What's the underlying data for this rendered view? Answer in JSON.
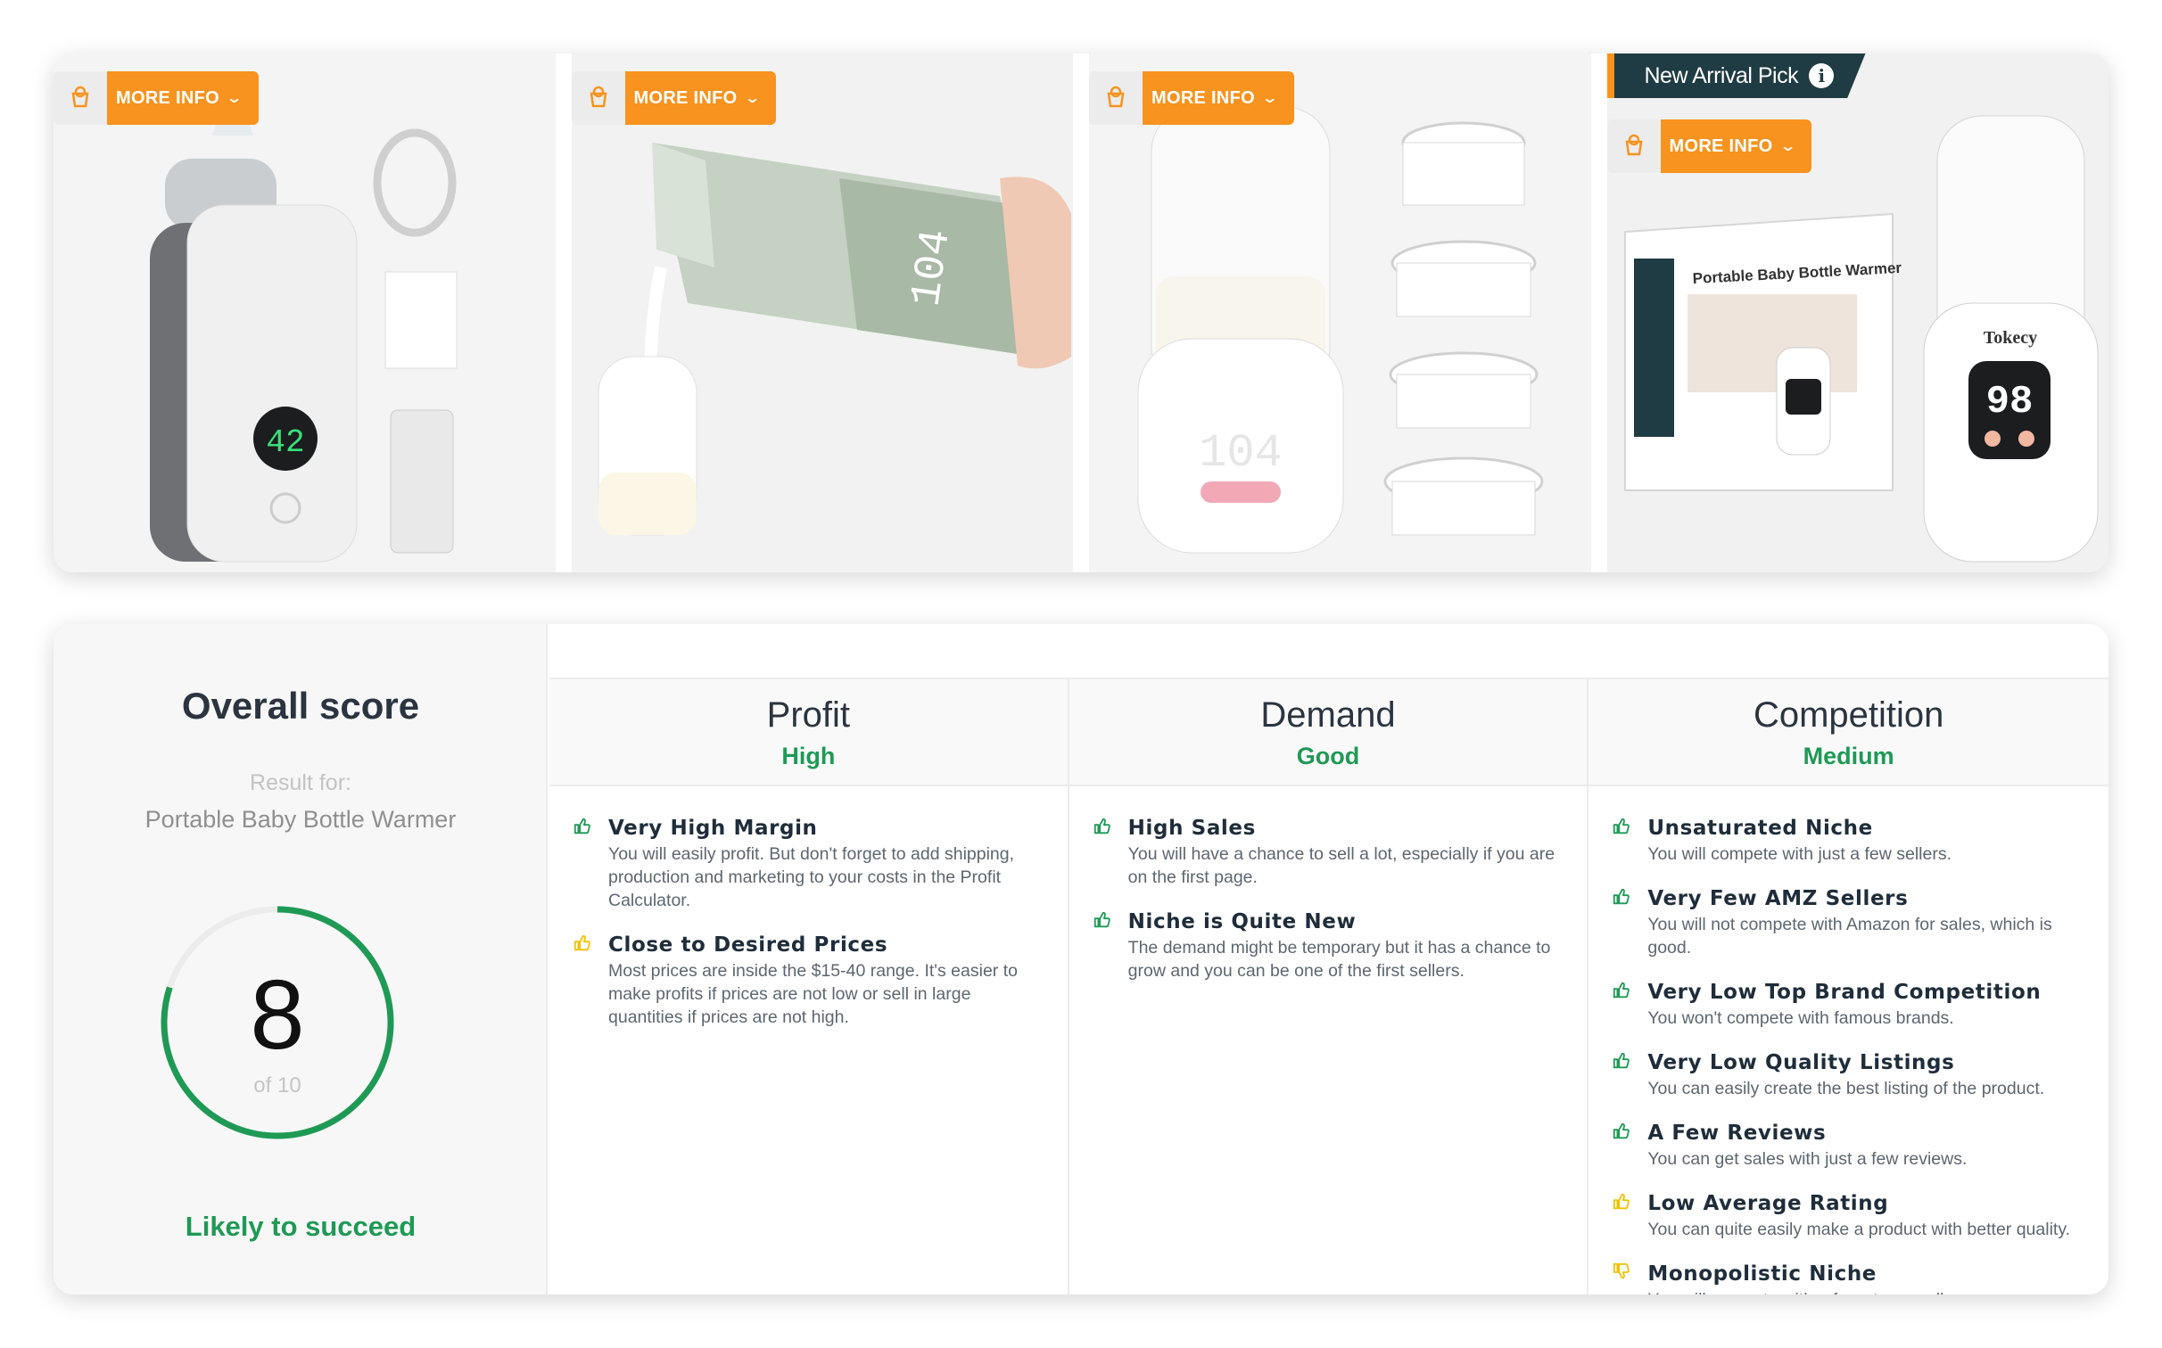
{
  "gallery": {
    "more_info_label": "MORE INFO",
    "badge_label": "New Arrival Pick",
    "accent_color": "#f7931e",
    "badge_color": "#1f3b43",
    "images": [
      {
        "display_labels": [
          "42"
        ]
      },
      {
        "display_labels": [
          "104"
        ]
      },
      {
        "display_labels": [
          "104"
        ]
      },
      {
        "display_labels": [
          "Portable Baby Bottle Warmer",
          "Tokecy",
          "98"
        ]
      }
    ]
  },
  "overall": {
    "title": "Overall score",
    "result_label": "Result for:",
    "result_value": "Portable Baby Bottle Warmer",
    "score": "8",
    "score_of": "of 10",
    "score_fraction": 0.8,
    "verdict": "Likely to succeed",
    "ring_color": "#1e9a55"
  },
  "categories": [
    {
      "title": "Profit",
      "rating": "High",
      "items": [
        {
          "icon": "thumbs-up-icon",
          "color": "#1e9a55",
          "title": "Very High Margin",
          "desc": "You will easily profit. But don't forget to add shipping, production and marketing to your costs in the Profit Calculator."
        },
        {
          "icon": "thumbs-up-icon",
          "color": "#f2c200",
          "title": "Close to Desired Prices",
          "desc": "Most prices are inside the $15-40 range. It's easier to make profits if prices are not low or sell in large quantities if prices are not high."
        }
      ]
    },
    {
      "title": "Demand",
      "rating": "Good",
      "items": [
        {
          "icon": "thumbs-up-icon",
          "color": "#1e9a55",
          "title": "High Sales",
          "desc": "You will have a chance to sell a lot, especially if you are on the first page."
        },
        {
          "icon": "thumbs-up-icon",
          "color": "#1e9a55",
          "title": "Niche is Quite New",
          "desc": "The demand might be temporary but it has a chance to grow and you can be one of the first sellers."
        }
      ]
    },
    {
      "title": "Competition",
      "rating": "Medium",
      "items": [
        {
          "icon": "thumbs-up-icon",
          "color": "#1e9a55",
          "title": "Unsaturated Niche",
          "desc": "You will compete with just a few sellers."
        },
        {
          "icon": "thumbs-up-icon",
          "color": "#1e9a55",
          "title": "Very Few AMZ Sellers",
          "desc": "You will not compete with Amazon for sales, which is good."
        },
        {
          "icon": "thumbs-up-icon",
          "color": "#1e9a55",
          "title": "Very Low Top Brand Competition",
          "desc": "You won't compete with famous brands."
        },
        {
          "icon": "thumbs-up-icon",
          "color": "#1e9a55",
          "title": "Very Low Quality Listings",
          "desc": "You can easily create the best listing of the product."
        },
        {
          "icon": "thumbs-up-icon",
          "color": "#1e9a55",
          "title": "A Few Reviews",
          "desc": "You can get sales with just a few reviews."
        },
        {
          "icon": "thumbs-up-icon",
          "color": "#f2c200",
          "title": "Low Average Rating",
          "desc": "You can quite easily make a product with better quality."
        },
        {
          "icon": "thumbs-down-icon",
          "color": "#f2c200",
          "title": "Monopolistic Niche",
          "desc": "You will compete with a few strong sellers."
        }
      ]
    }
  ]
}
